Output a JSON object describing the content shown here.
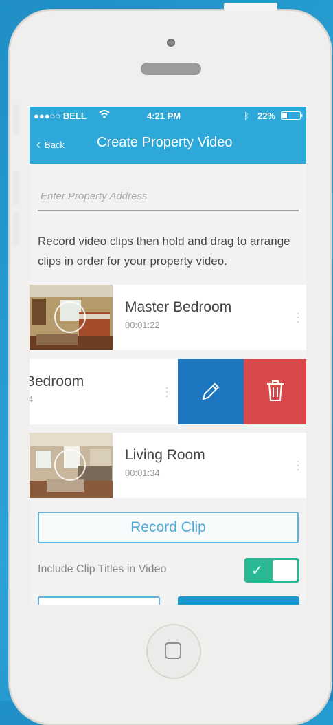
{
  "status_bar": {
    "carrier": "●●●○○ BELL",
    "time": "4:21 PM",
    "battery": "22%"
  },
  "nav": {
    "back_label": "Back",
    "title": "Create Property Video"
  },
  "address": {
    "placeholder": "Enter Property Address",
    "value": ""
  },
  "instructions": "Record video clips then hold and drag to arrange clips in order for your property video.",
  "clips": [
    {
      "title": "Master Bedroom",
      "duration": "00:01:22"
    },
    {
      "title": "Bedroom",
      "duration": "4"
    },
    {
      "title": "Living Room",
      "duration": "00:01:34"
    }
  ],
  "actions": {
    "record_label": "Record Clip"
  },
  "toggle": {
    "label": "Include Clip Titles in Video",
    "state": "on"
  },
  "colors": {
    "primary": "#2ea8d8",
    "edit": "#1c76c0",
    "delete": "#d9484a",
    "toggle_on": "#2ab794"
  }
}
